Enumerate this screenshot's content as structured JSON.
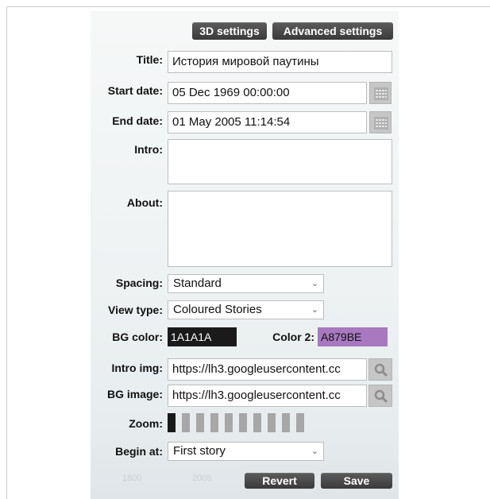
{
  "top_buttons": {
    "settings_3d": "3D settings",
    "advanced": "Advanced settings"
  },
  "form": {
    "title": {
      "label": "Title:",
      "value": "История мировой паутины"
    },
    "start_date": {
      "label": "Start date:",
      "value": "05 Dec 1969 00:00:00",
      "icon": "calendar-icon"
    },
    "end_date": {
      "label": "End date:",
      "value": "01 May 2005 11:14:54",
      "icon": "calendar-icon"
    },
    "intro": {
      "label": "Intro:",
      "value": ""
    },
    "about": {
      "label": "About:",
      "value": ""
    },
    "spacing": {
      "label": "Spacing:",
      "value": "Standard"
    },
    "view_type": {
      "label": "View type:",
      "value": "Coloured Stories"
    },
    "bg_color": {
      "label": "BG color:",
      "value": "1A1A1A",
      "swatch": "#1A1A1A",
      "text_color": "#ffffff"
    },
    "color2": {
      "label": "Color 2:",
      "value": "A879BE",
      "swatch": "#A879BE",
      "text_color": "#111111"
    },
    "intro_img": {
      "label": "Intro img:",
      "value": "https://lh3.googleusercontent.cc",
      "icon": "search-icon"
    },
    "bg_image": {
      "label": "BG image:",
      "value": "https://lh3.googleusercontent.cc",
      "icon": "search-icon"
    },
    "zoom": {
      "label": "Zoom:",
      "level": 1,
      "max": 10
    },
    "begin_at": {
      "label": "Begin at:",
      "value": "First story"
    }
  },
  "actions": {
    "revert": "Revert",
    "save": "Save"
  },
  "background_timeline": [
    "1800",
    "2005"
  ]
}
